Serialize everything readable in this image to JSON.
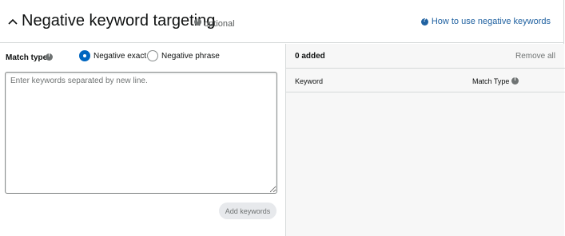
{
  "header": {
    "title": "Negative keyword targeting",
    "optional_label": "optional",
    "help_link": "How to use negative keywords"
  },
  "form": {
    "match_type_label": "Match type",
    "options": [
      {
        "label": "Negative exact",
        "selected": true
      },
      {
        "label": "Negative phrase",
        "selected": false
      }
    ],
    "keywords_placeholder": "Enter keywords separated by new line.",
    "keywords_value": "",
    "add_button": "Add keywords"
  },
  "added_panel": {
    "count_label": "0 added",
    "remove_all": "Remove all",
    "columns": [
      "Keyword",
      "Match Type"
    ]
  },
  "colors": {
    "link": "#2162a1",
    "radio_selected": "#0066c0",
    "panel_bg": "#f7f7f7",
    "border": "#d5d9d9"
  },
  "icons": [
    "chevron-up-icon",
    "info-icon",
    "help-question-icon"
  ]
}
